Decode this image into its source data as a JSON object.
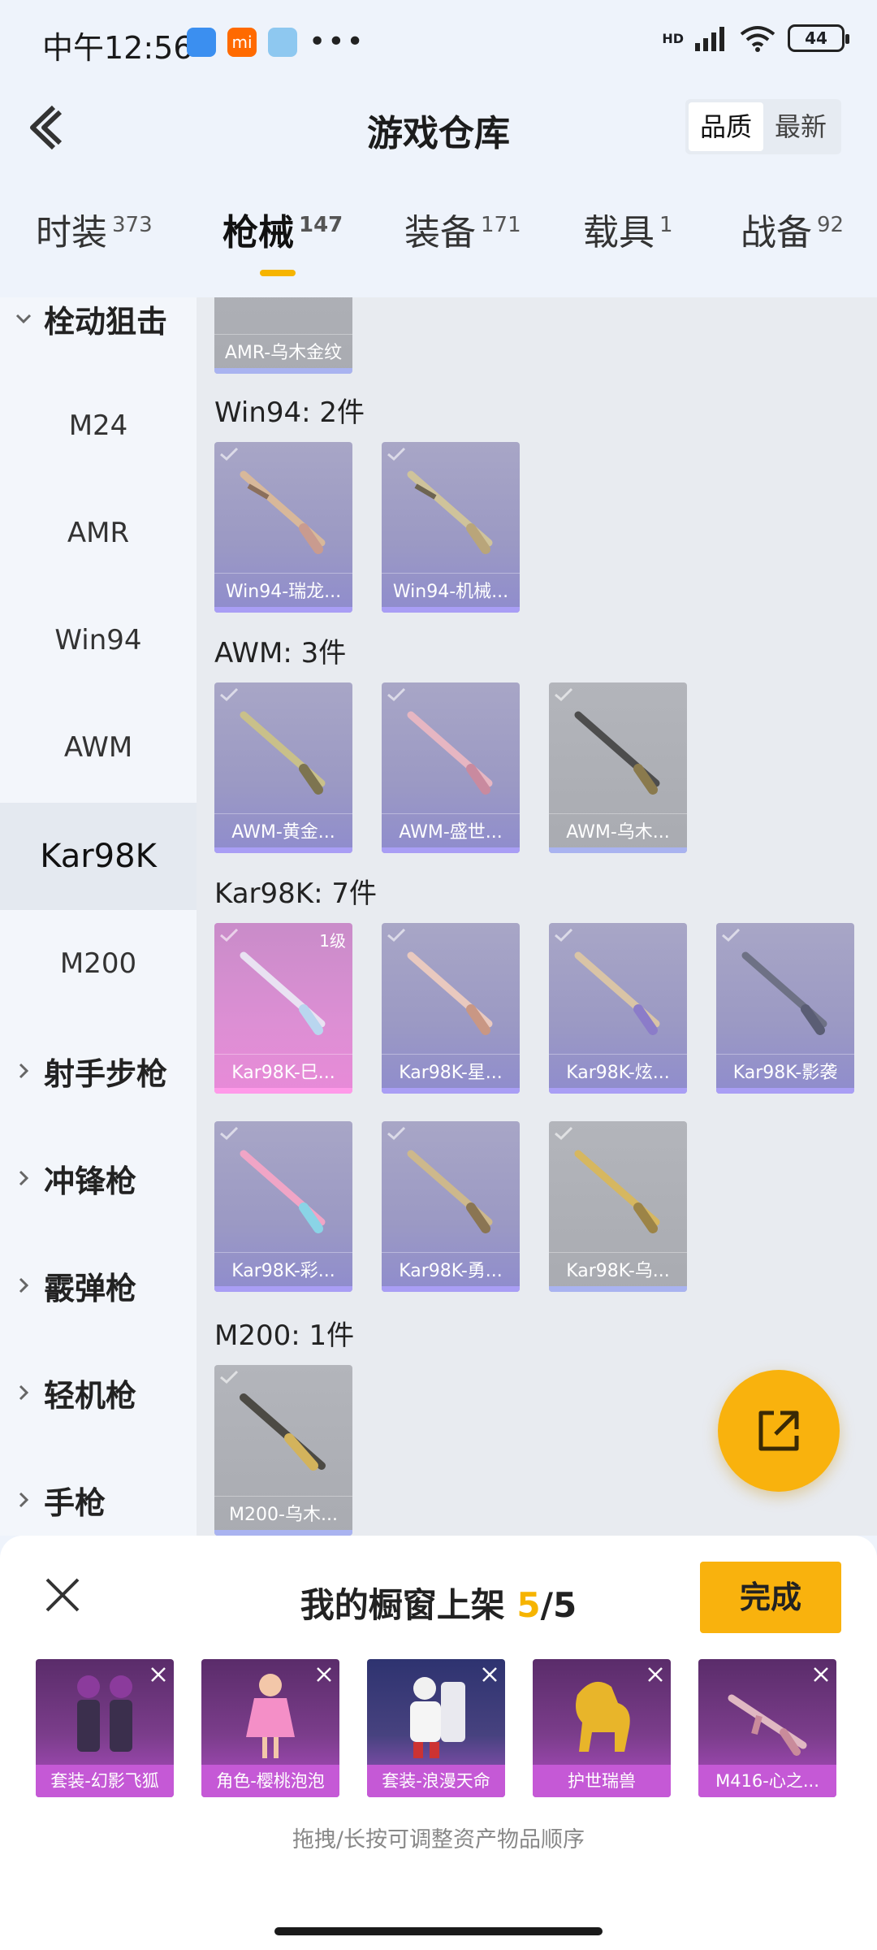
{
  "status_bar": {
    "time": "中午12:56",
    "network": "HD",
    "battery": "44",
    "app_icons": [
      "app-blue-icon",
      "mi-icon",
      "app-elephant-icon"
    ],
    "app_mi_text": "mi",
    "more_dots": "•••"
  },
  "header": {
    "title": "游戏仓库",
    "sort_options": [
      "品质",
      "最新"
    ],
    "sort_selected": "品质"
  },
  "tabs": [
    {
      "label": "时装",
      "count": "373"
    },
    {
      "label": "枪械",
      "count": "147",
      "active": true
    },
    {
      "label": "装备",
      "count": "171"
    },
    {
      "label": "载具",
      "count": "1"
    },
    {
      "label": "战备",
      "count": "92"
    }
  ],
  "sidebar": {
    "groups": [
      {
        "label": "栓动狙击",
        "expanded": true
      },
      {
        "label": "射手步枪",
        "expanded": false
      },
      {
        "label": "冲锋枪",
        "expanded": false
      },
      {
        "label": "霰弹枪",
        "expanded": false
      },
      {
        "label": "轻机枪",
        "expanded": false
      },
      {
        "label": "手枪",
        "expanded": false
      }
    ],
    "sub_items": [
      "M24",
      "AMR",
      "Win94",
      "AWM",
      "Kar98K",
      "M200"
    ],
    "active_item": "Kar98K"
  },
  "content": {
    "top_card_label": "AMR-乌木金纹",
    "sections": [
      {
        "title": "Win94: 2件",
        "items": [
          "Win94-瑞龙...",
          "Win94-机械..."
        ]
      },
      {
        "title": "AWM: 3件",
        "items": [
          "AWM-黄金...",
          "AWM-盛世...",
          "AWM-乌木..."
        ]
      },
      {
        "title": "Kar98K: 7件",
        "items": [
          "Kar98K-巳...",
          "Kar98K-星...",
          "Kar98K-炫...",
          "Kar98K-影袭",
          "Kar98K-彩...",
          "Kar98K-勇...",
          "Kar98K-乌..."
        ]
      },
      {
        "title": "M200: 1件",
        "items": [
          "M200-乌木..."
        ]
      }
    ],
    "level_badge": "1级"
  },
  "sheet": {
    "title": "我的橱窗上架",
    "current": "5",
    "total": "/5",
    "done_label": "完成",
    "items": [
      "套装-幻影飞狐",
      "角色-樱桃泡泡",
      "套装-浪漫天命",
      "护世瑞兽",
      "M416-心之..."
    ],
    "hint": "拖拽/长按可调整资产物品顺序"
  },
  "colors": {
    "accent": "#f9b20d",
    "purple_card": "#9b99c4",
    "gray_card": "#a9abb1",
    "pink_card": "#e88ad8",
    "showcase_label": "#c559d6"
  }
}
